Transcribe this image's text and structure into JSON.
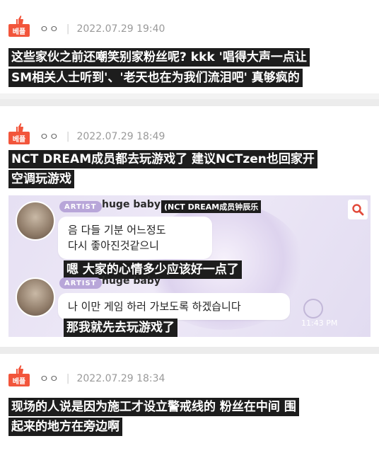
{
  "posts": [
    {
      "badge": "베플",
      "author": "ㅇㅇ",
      "sep": "|",
      "date": "2022.07.29 19:40",
      "caption_lines": [
        "这些家伙之前还嘲笑别家粉丝呢? kkk '唱得大声一点让",
        "SM相关人士听到'、'老天也在为我们流泪吧' 真够疯的"
      ]
    },
    {
      "badge": "베플",
      "author": "ㅇㅇ",
      "sep": "|",
      "date": "2022.07.29 18:49",
      "caption_lines": [
        "NCT DREAM成员都去玩游戏了 建议NCTzen也回家开",
        "空调玩游戏"
      ]
    },
    {
      "badge": "베플",
      "author": "ㅇㅇ",
      "sep": "|",
      "date": "2022.07.29 18:34",
      "caption_lines": [
        "现场的人说是因为施工才设立警戒线的 粉丝在中间 围",
        "起来的地方在旁边啊"
      ]
    }
  ],
  "chat": {
    "artist_tag": "ARTIST",
    "username": "huge baby",
    "member_caption": "(NCT DREAM成员钟辰乐",
    "msg1_lines": [
      "음 다들 기분 어느정도",
      "다시 좋아진것같으니"
    ],
    "msg1_caption": "嗯 大家的心情多少应该好一点了",
    "msg2": "나 이만 게임 하러 가보도록 하겠습니다",
    "msg2_caption": "那我就先去玩游戏了",
    "time": "11:43 PM"
  },
  "colors": {
    "badge": "#f2553b",
    "caption_bg": "#1d1d1d",
    "artist_tag": "#b8a6d9"
  }
}
